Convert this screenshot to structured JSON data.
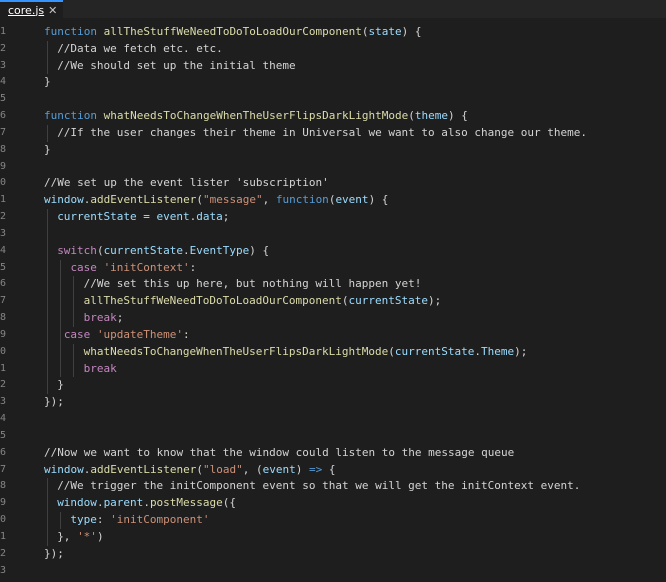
{
  "tab": {
    "filename": "core.js",
    "close_glyph": "✕"
  },
  "colors": {
    "background": "#1e1e1e",
    "keyword": "#569cd6",
    "function": "#dcdcaa",
    "variable": "#9cdcfe",
    "string": "#ce9178",
    "control": "#c586c0",
    "plain": "#d4d4d4",
    "line_number": "#858585"
  },
  "lines": [
    {
      "n": "1",
      "indent": 0,
      "tokens": [
        [
          "kw",
          "function "
        ],
        [
          "fn",
          "allTheStuffWeNeedToDoToLoadOurComponent"
        ],
        [
          "pl",
          "("
        ],
        [
          "vr",
          "state"
        ],
        [
          "pl",
          ") {"
        ]
      ]
    },
    {
      "n": "2",
      "indent": 1,
      "tokens": [
        [
          "cmt",
          "//Data we fetch etc. etc."
        ]
      ]
    },
    {
      "n": "3",
      "indent": 1,
      "tokens": [
        [
          "cmt",
          "//We should set up the initial theme"
        ]
      ]
    },
    {
      "n": "4",
      "indent": 0,
      "tokens": [
        [
          "pl",
          "}"
        ]
      ]
    },
    {
      "n": "5",
      "indent": 0,
      "tokens": []
    },
    {
      "n": "6",
      "indent": 0,
      "tokens": [
        [
          "kw",
          "function "
        ],
        [
          "fn",
          "whatNeedsToChangeWhenTheUserFlipsDarkLightMode"
        ],
        [
          "pl",
          "("
        ],
        [
          "vr",
          "theme"
        ],
        [
          "pl",
          ") {"
        ]
      ]
    },
    {
      "n": "7",
      "indent": 1,
      "tokens": [
        [
          "cmt",
          "//If the user changes their theme in Universal we want to also change our theme."
        ]
      ]
    },
    {
      "n": "8",
      "indent": 0,
      "tokens": [
        [
          "pl",
          "}"
        ]
      ]
    },
    {
      "n": "9",
      "indent": 0,
      "tokens": []
    },
    {
      "n": "0",
      "indent": 0,
      "tokens": [
        [
          "cmt",
          "//We set up the event lister 'subscription'"
        ]
      ]
    },
    {
      "n": "1",
      "indent": 0,
      "tokens": [
        [
          "vr",
          "window"
        ],
        [
          "pl",
          "."
        ],
        [
          "fn",
          "addEventListener"
        ],
        [
          "pl",
          "("
        ],
        [
          "str",
          "\"message\""
        ],
        [
          "pl",
          ", "
        ],
        [
          "kw",
          "function"
        ],
        [
          "pl",
          "("
        ],
        [
          "vr",
          "event"
        ],
        [
          "pl",
          ") {"
        ]
      ]
    },
    {
      "n": "2",
      "indent": 1,
      "tokens": [
        [
          "vr",
          "currentState"
        ],
        [
          "pl",
          " = "
        ],
        [
          "vr",
          "event"
        ],
        [
          "pl",
          "."
        ],
        [
          "vr",
          "data"
        ],
        [
          "pl",
          ";"
        ]
      ]
    },
    {
      "n": "3",
      "indent": 1,
      "tokens": []
    },
    {
      "n": "4",
      "indent": 1,
      "tokens": [
        [
          "pk",
          "switch"
        ],
        [
          "pl",
          "("
        ],
        [
          "vr",
          "currentState"
        ],
        [
          "pl",
          "."
        ],
        [
          "vr",
          "EventType"
        ],
        [
          "pl",
          ") {"
        ]
      ]
    },
    {
      "n": "5",
      "indent": 2,
      "pad": 2,
      "tokens": [
        [
          "pk",
          "case "
        ],
        [
          "str",
          "'initContext'"
        ],
        [
          "pl",
          ":"
        ]
      ]
    },
    {
      "n": "6",
      "indent": 3,
      "tokens": [
        [
          "cmt",
          "//We set this up here, but nothing will happen yet!"
        ]
      ]
    },
    {
      "n": "7",
      "indent": 3,
      "tokens": [
        [
          "fn",
          "allTheStuffWeNeedToDoToLoadOurComponent"
        ],
        [
          "pl",
          "("
        ],
        [
          "vr",
          "currentState"
        ],
        [
          "pl",
          ");"
        ]
      ]
    },
    {
      "n": "8",
      "indent": 3,
      "tokens": [
        [
          "pk",
          "break"
        ],
        [
          "pl",
          ";"
        ]
      ]
    },
    {
      "n": "9",
      "indent": 2,
      "pad": 1,
      "tokens": [
        [
          "pk",
          "case "
        ],
        [
          "str",
          "'updateTheme'"
        ],
        [
          "pl",
          ":"
        ]
      ]
    },
    {
      "n": "0",
      "indent": 3,
      "tokens": [
        [
          "fn",
          "whatNeedsToChangeWhenTheUserFlipsDarkLightMode"
        ],
        [
          "pl",
          "("
        ],
        [
          "vr",
          "currentState"
        ],
        [
          "pl",
          "."
        ],
        [
          "vr",
          "Theme"
        ],
        [
          "pl",
          ");"
        ]
      ]
    },
    {
      "n": "1",
      "indent": 3,
      "tokens": [
        [
          "pk",
          "break"
        ]
      ]
    },
    {
      "n": "2",
      "indent": 1,
      "tokens": [
        [
          "pl",
          "}"
        ]
      ]
    },
    {
      "n": "3",
      "indent": 0,
      "tokens": [
        [
          "pl",
          "});"
        ]
      ]
    },
    {
      "n": "4",
      "indent": 0,
      "tokens": []
    },
    {
      "n": "5",
      "indent": 0,
      "tokens": []
    },
    {
      "n": "6",
      "indent": 0,
      "tokens": [
        [
          "cmt",
          "//Now we want to know that the window could listen to the message queue"
        ]
      ]
    },
    {
      "n": "7",
      "indent": 0,
      "tokens": [
        [
          "vr",
          "window"
        ],
        [
          "pl",
          "."
        ],
        [
          "fn",
          "addEventListener"
        ],
        [
          "pl",
          "("
        ],
        [
          "str",
          "\"load\""
        ],
        [
          "pl",
          ", ("
        ],
        [
          "vr",
          "event"
        ],
        [
          "pl",
          ") "
        ],
        [
          "kw",
          "=>"
        ],
        [
          "pl",
          " {"
        ]
      ]
    },
    {
      "n": "8",
      "indent": 1,
      "tokens": [
        [
          "cmt",
          "//We trigger the initComponent event so that we will get the initContext event."
        ]
      ]
    },
    {
      "n": "9",
      "indent": 1,
      "tokens": [
        [
          "vr",
          "window"
        ],
        [
          "pl",
          "."
        ],
        [
          "vr",
          "parent"
        ],
        [
          "pl",
          "."
        ],
        [
          "fn",
          "postMessage"
        ],
        [
          "pl",
          "({"
        ]
      ]
    },
    {
      "n": "0",
      "indent": 2,
      "tokens": [
        [
          "vr",
          "type"
        ],
        [
          "pl",
          ": "
        ],
        [
          "str",
          "'initComponent'"
        ]
      ]
    },
    {
      "n": "1",
      "indent": 1,
      "tokens": [
        [
          "pl",
          "}, "
        ],
        [
          "str",
          "'*'"
        ],
        [
          "pl",
          ")"
        ]
      ]
    },
    {
      "n": "2",
      "indent": 0,
      "tokens": [
        [
          "pl",
          "});"
        ]
      ]
    },
    {
      "n": "3",
      "indent": 0,
      "tokens": []
    }
  ]
}
